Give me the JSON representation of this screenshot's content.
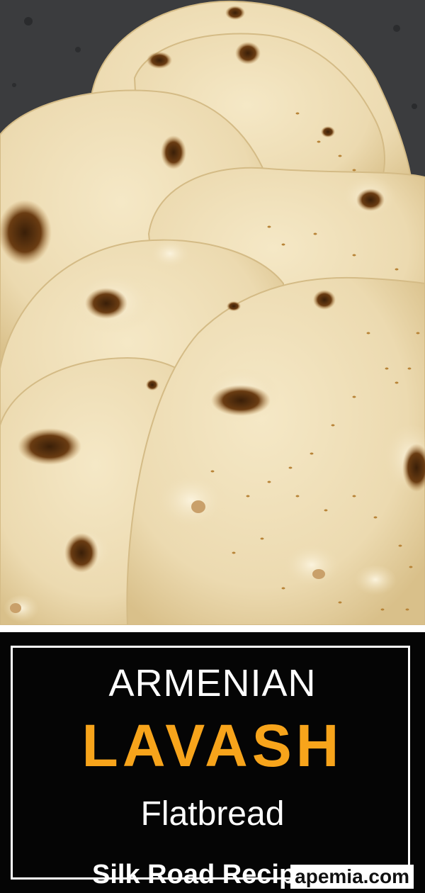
{
  "photo": {
    "subject": "stacked homemade flatbreads with charred spots and sesame seeds on a dark stone surface",
    "colors": {
      "background_stone": "#3a3b3d",
      "bread": "#eddcb3",
      "bread_shadow": "#c9b07a",
      "char": "#5a3510",
      "sesame": "#c08a3c"
    }
  },
  "banner": {
    "line1": "ARMENIAN",
    "line2": "LAVASH",
    "line3": "Flatbread",
    "credit": "Silk Road Recipes",
    "watermark": "apemia.com",
    "colors": {
      "background": "#050505",
      "text": "#ffffff",
      "accent": "#f7a41b"
    }
  }
}
